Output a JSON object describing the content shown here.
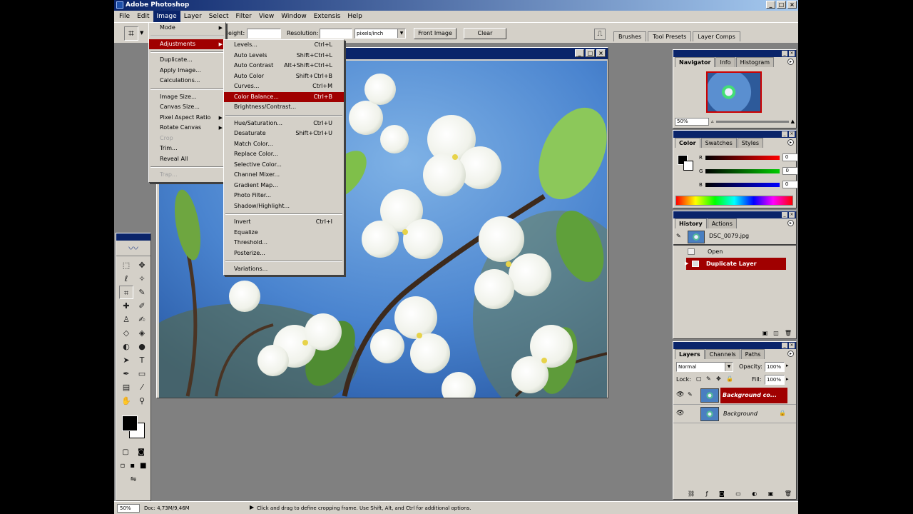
{
  "window": {
    "title": "Adobe Photoshop"
  },
  "menubar": [
    "File",
    "Edit",
    "Image",
    "Layer",
    "Select",
    "Filter",
    "View",
    "Window",
    "Extensis",
    "Help"
  ],
  "options": {
    "height_label": "Height:",
    "resolution_label": "Resolution:",
    "units": "pixels/inch",
    "front_image": "Front Image",
    "clear": "Clear"
  },
  "wells": [
    "Brushes",
    "Tool Presets",
    "Layer Comps"
  ],
  "image_menu": [
    {
      "label": "Mode",
      "submenu": true
    },
    {
      "sep": true
    },
    {
      "label": "Adjustments",
      "submenu": true,
      "highlight": true
    },
    {
      "sep": true
    },
    {
      "label": "Duplicate..."
    },
    {
      "label": "Apply Image..."
    },
    {
      "label": "Calculations..."
    },
    {
      "sep": true
    },
    {
      "label": "Image Size..."
    },
    {
      "label": "Canvas Size..."
    },
    {
      "label": "Pixel Aspect Ratio",
      "submenu": true
    },
    {
      "label": "Rotate Canvas",
      "submenu": true
    },
    {
      "label": "Crop",
      "disabled": true
    },
    {
      "label": "Trim..."
    },
    {
      "label": "Reveal All"
    },
    {
      "sep": true
    },
    {
      "label": "Trap...",
      "disabled": true
    }
  ],
  "adjustments_menu": [
    {
      "label": "Levels...",
      "shortcut": "Ctrl+L"
    },
    {
      "label": "Auto Levels",
      "shortcut": "Shift+Ctrl+L"
    },
    {
      "label": "Auto Contrast",
      "shortcut": "Alt+Shift+Ctrl+L"
    },
    {
      "label": "Auto Color",
      "shortcut": "Shift+Ctrl+B"
    },
    {
      "label": "Curves...",
      "shortcut": "Ctrl+M"
    },
    {
      "label": "Color Balance...",
      "shortcut": "Ctrl+B",
      "highlight": true
    },
    {
      "label": "Brightness/Contrast..."
    },
    {
      "sep": true
    },
    {
      "label": "Hue/Saturation...",
      "shortcut": "Ctrl+U"
    },
    {
      "label": "Desaturate",
      "shortcut": "Shift+Ctrl+U"
    },
    {
      "label": "Match Color..."
    },
    {
      "label": "Replace Color..."
    },
    {
      "label": "Selective Color..."
    },
    {
      "label": "Channel Mixer..."
    },
    {
      "label": "Gradient Map..."
    },
    {
      "label": "Photo Filter..."
    },
    {
      "label": "Shadow/Highlight..."
    },
    {
      "sep": true
    },
    {
      "label": "Invert",
      "shortcut": "Ctrl+I"
    },
    {
      "label": "Equalize"
    },
    {
      "label": "Threshold..."
    },
    {
      "label": "Posterize..."
    },
    {
      "sep": true
    },
    {
      "label": "Variations..."
    }
  ],
  "navigator": {
    "tabs": [
      "Navigator",
      "Info",
      "Histogram"
    ],
    "zoom": "50%"
  },
  "color": {
    "tabs": [
      "Color",
      "Swatches",
      "Styles"
    ],
    "channels": [
      {
        "name": "R",
        "value": "0",
        "bar": "#ff0000"
      },
      {
        "name": "G",
        "value": "0",
        "bar": "#00c000"
      },
      {
        "name": "B",
        "value": "0",
        "bar": "#0000ff"
      }
    ]
  },
  "history": {
    "tabs": [
      "History",
      "Actions"
    ],
    "snapshot": "DSC_0079.jpg",
    "steps": [
      "Open",
      "Duplicate Layer"
    ]
  },
  "layers": {
    "tabs": [
      "Layers",
      "Channels",
      "Paths"
    ],
    "blend_mode": "Normal",
    "opacity_label": "Opacity:",
    "opacity": "100%",
    "lock_label": "Lock:",
    "fill_label": "Fill:",
    "fill": "100%",
    "items": [
      {
        "name": "Background co...",
        "active": true
      },
      {
        "name": "Background",
        "active": false
      }
    ]
  },
  "status": {
    "zoom": "50%",
    "doc": "Doc: 4,73M/9,46M",
    "hint": "Click and drag to define cropping frame. Use Shift, Alt, and Ctrl for additional options."
  }
}
